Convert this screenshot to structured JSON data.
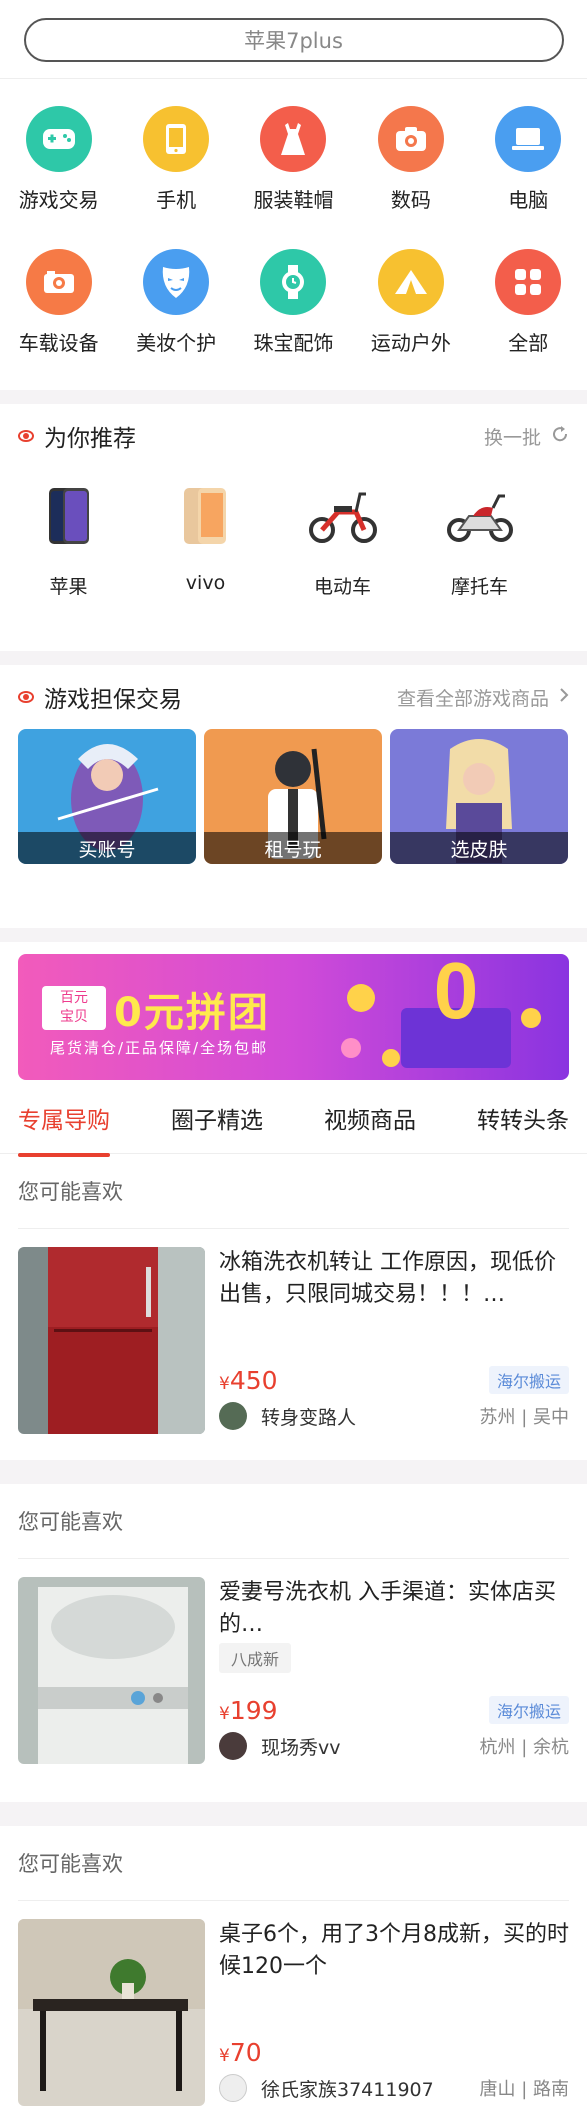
{
  "search": {
    "placeholder": "苹果7plus"
  },
  "categories": [
    {
      "label": "游戏交易",
      "icon": "gamepad-icon",
      "color": "#2ec8a8"
    },
    {
      "label": "手机",
      "icon": "phone-icon",
      "color": "#f7c130"
    },
    {
      "label": "服装鞋帽",
      "icon": "dress-icon",
      "color": "#f35e4b"
    },
    {
      "label": "数码",
      "icon": "camera-icon",
      "color": "#f4774c"
    },
    {
      "label": "电脑",
      "icon": "laptop-icon",
      "color": "#4a9ef0"
    },
    {
      "label": "车载设备",
      "icon": "car-camera-icon",
      "color": "#f67a46"
    },
    {
      "label": "美妆个护",
      "icon": "mask-icon",
      "color": "#4a9ef0"
    },
    {
      "label": "珠宝配饰",
      "icon": "watch-icon",
      "color": "#2ec8a8"
    },
    {
      "label": "运动户外",
      "icon": "tent-icon",
      "color": "#f7c130"
    },
    {
      "label": "全部",
      "icon": "grid-icon",
      "color": "#f35e4b"
    }
  ],
  "recommend": {
    "title": "为你推荐",
    "refresh_label": "换一批",
    "items": [
      {
        "label": "苹果",
        "icon": "iphone-icon"
      },
      {
        "label": "vivo",
        "icon": "vivo-phone-icon"
      },
      {
        "label": "电动车",
        "icon": "ebike-icon"
      },
      {
        "label": "摩托车",
        "icon": "motorcycle-icon"
      }
    ]
  },
  "game": {
    "title": "游戏担保交易",
    "more_label": "查看全部游戏商品",
    "cards": [
      {
        "label": "买账号",
        "color": "#3fa2e0"
      },
      {
        "label": "租号玩",
        "color": "#f09a50"
      },
      {
        "label": "选皮肤",
        "color": "#7b7ad8"
      }
    ]
  },
  "banner": {
    "badge_line1": "百元",
    "badge_line2": "宝贝",
    "title": "0元拼团",
    "subtitle": "尾货清仓/正品保障/全场包邮"
  },
  "tabs": [
    "专属导购",
    "圈子精选",
    "视频商品",
    "转转头条"
  ],
  "feed": [
    {
      "section_label": "您可能喜欢",
      "title": "冰箱洗衣机转让 工作原因，现低价出售，只限同城交易！！！…",
      "condition": "",
      "price_symbol": "¥",
      "price": "450",
      "tag": "海尔搬运",
      "user": "转身变路人",
      "location": "苏州 | 吴中",
      "image": "fridge"
    },
    {
      "section_label": "您可能喜欢",
      "title": "爱妻号洗衣机 入手渠道：实体店买的…",
      "condition": "八成新",
      "price_symbol": "¥",
      "price": "199",
      "tag": "海尔搬运",
      "user": "现场秀vv",
      "location": "杭州 | 余杭",
      "image": "washer"
    },
    {
      "section_label": "您可能喜欢",
      "title": "桌子6个，用了3个月8成新，买的时候120一个",
      "condition": "",
      "price_symbol": "¥",
      "price": "70",
      "tag": "",
      "user": "徐氏家族37411907",
      "location": "唐山 | 路南",
      "image": "table"
    }
  ]
}
